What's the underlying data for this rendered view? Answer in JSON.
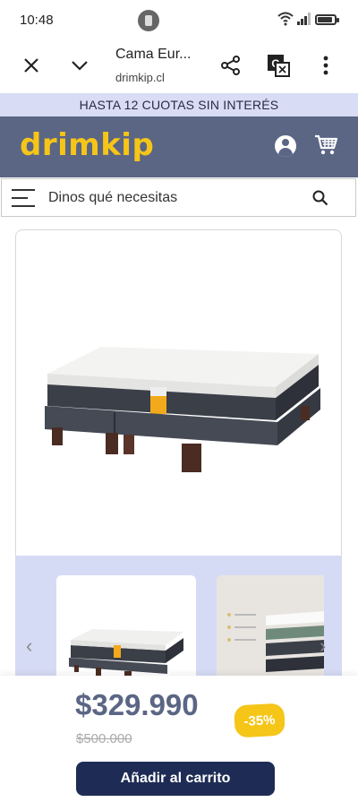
{
  "status_bar": {
    "time": "10:48",
    "battery_level": 0.8
  },
  "toolbar": {
    "page_title": "Cama Eur...",
    "domain": "drimkip.cl"
  },
  "promo": {
    "text": "HASTA 12 CUOTAS SIN INTERÉS"
  },
  "header": {
    "logo": "drimkip"
  },
  "search": {
    "placeholder": "Dinos qué necesitas"
  },
  "product": {
    "price": "$329.990",
    "old_price": "$500.000",
    "discount": "-35%",
    "add_to_cart": "Añadir al carrito"
  },
  "colors": {
    "header_bg": "#5b6584",
    "brand_yellow": "#f5c518",
    "promo_bg": "#d8dcf5",
    "button_bg": "#1e2c55"
  }
}
